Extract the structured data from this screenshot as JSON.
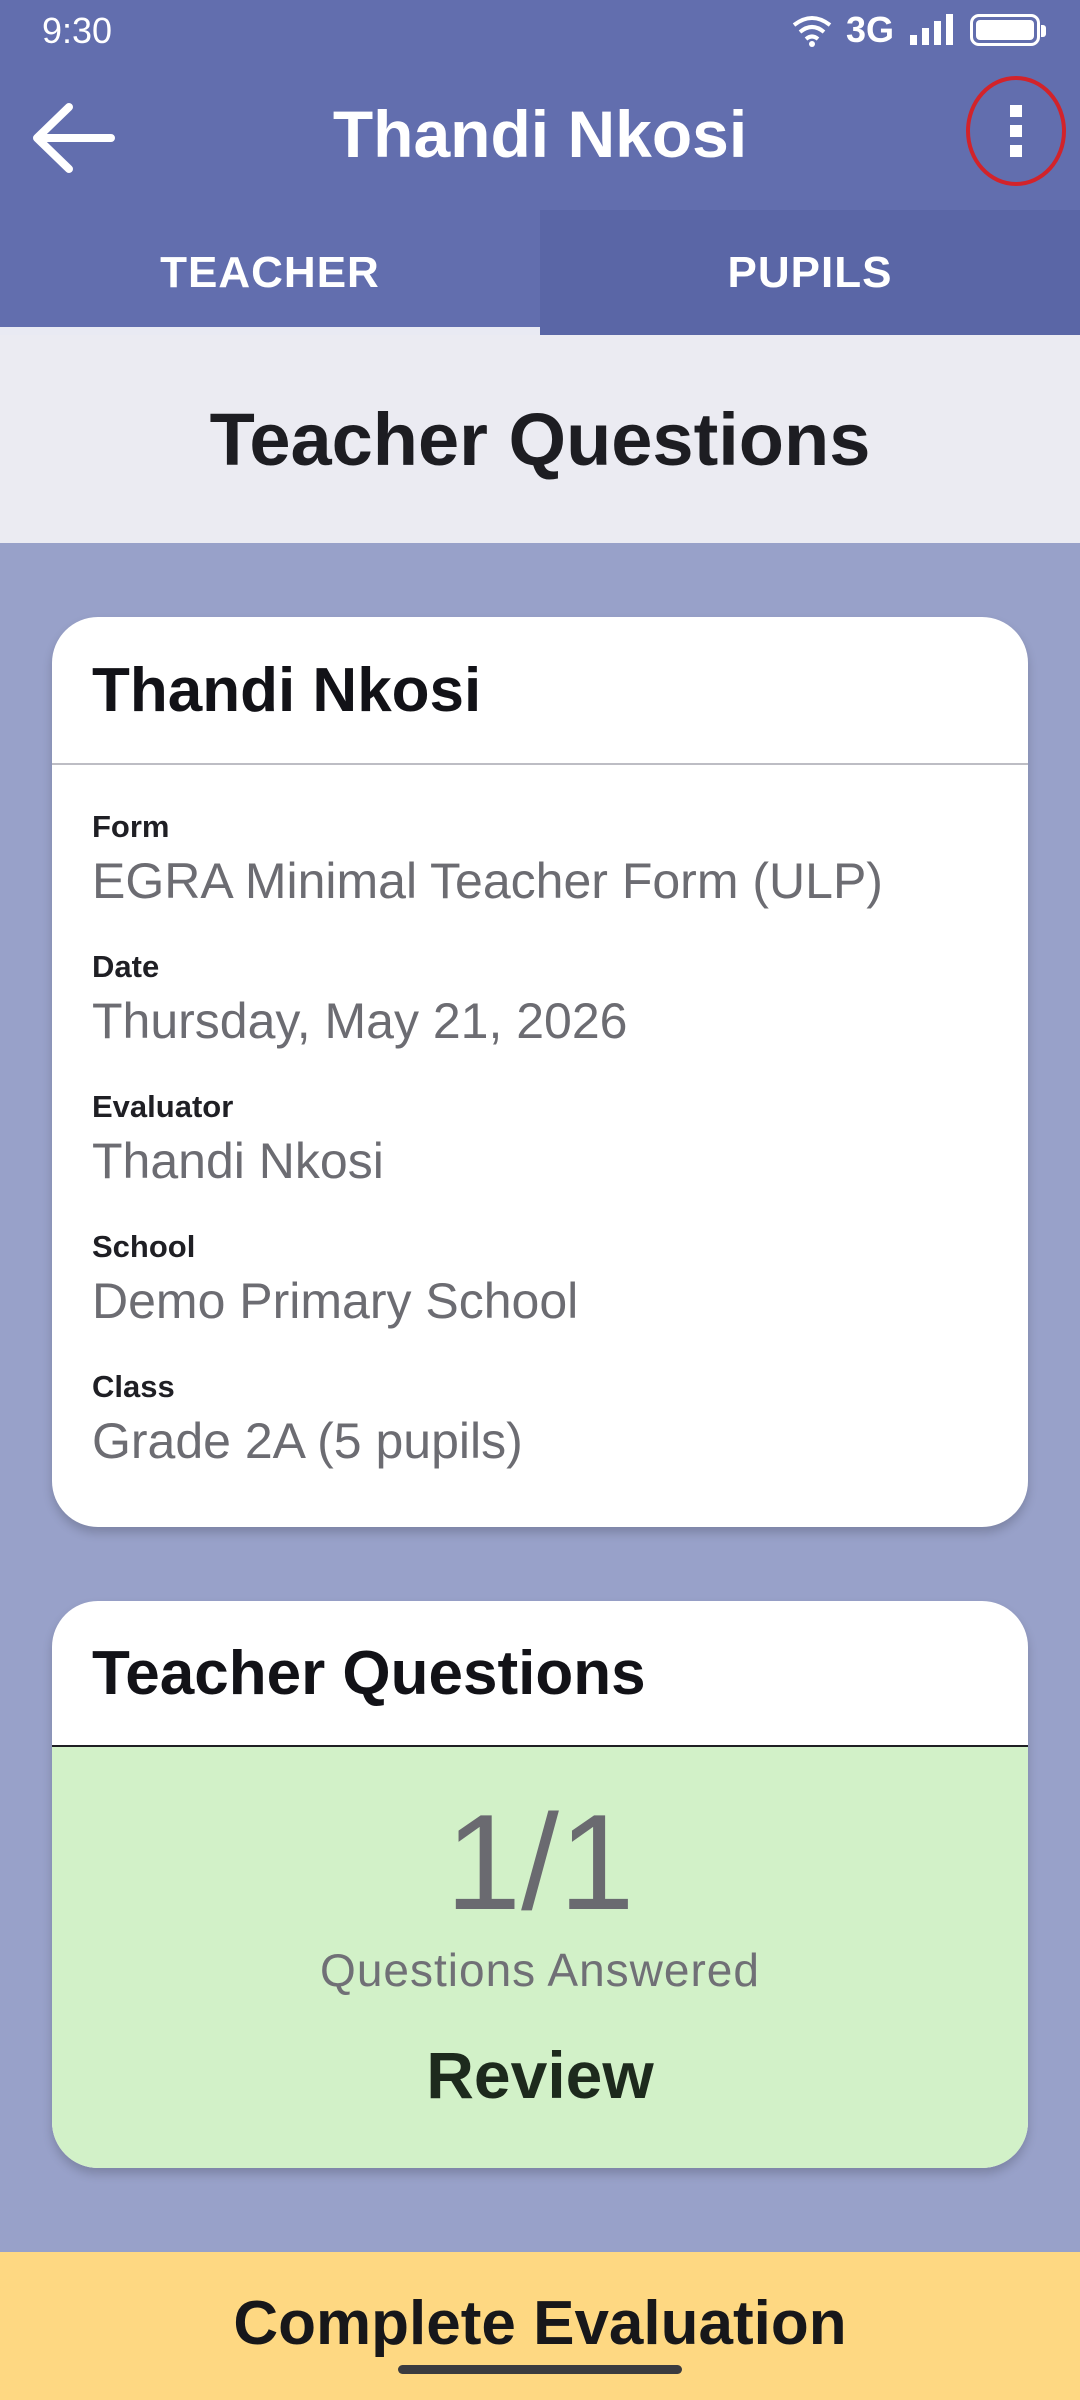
{
  "status_bar": {
    "time": "9:30",
    "network": "3G"
  },
  "app_bar": {
    "title": "Thandi Nkosi",
    "back_icon": "arrow-left-icon",
    "menu_icon": "more-vertical-icon"
  },
  "tabs": [
    {
      "label": "TEACHER",
      "selected": true
    },
    {
      "label": "PUPILS",
      "selected": false
    }
  ],
  "section_header": "Teacher Questions",
  "info_card": {
    "title": "Thandi Nkosi",
    "fields": [
      {
        "label": "Form",
        "value": "EGRA Minimal Teacher Form (ULP)"
      },
      {
        "label": "Date",
        "value": "Thursday, May 21, 2026"
      },
      {
        "label": "Evaluator",
        "value": "Thandi Nkosi"
      },
      {
        "label": "School",
        "value": "Demo Primary School"
      },
      {
        "label": "Class",
        "value": "Grade 2A (5 pupils)"
      }
    ]
  },
  "questions_card": {
    "title": "Teacher Questions",
    "count": "1/1",
    "caption": "Questions Answered",
    "action": "Review"
  },
  "complete_button": "Complete Evaluation",
  "colors": {
    "app_bar": "#626eae",
    "background": "#98a1c9",
    "answered_bg": "#d2f1c8",
    "complete_bg": "#fed882",
    "highlight_ring": "#d2232a"
  }
}
